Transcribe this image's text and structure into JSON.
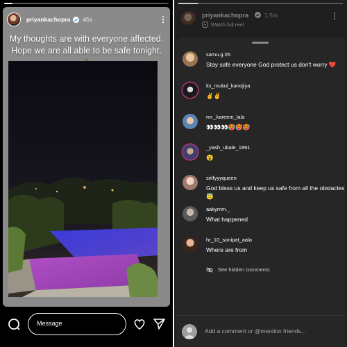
{
  "story": {
    "username": "priyankachopra",
    "time_ago": "45s",
    "caption": "My thoughts are with everyone affected. Hope we are all able to be safe tonight.",
    "caption_emoji": "🙏🏽",
    "message_placeholder": "Message",
    "progress": 0.05
  },
  "comments_view": {
    "username": "priyankachopra",
    "time_ago": "1.5m",
    "watch_full_reel": "Watch full reel",
    "comments": [
      {
        "user": "samu.g.05",
        "text": "Stay safe everyone God protect us don't worry ❤️",
        "avatar_color": "#c9a27a"
      },
      {
        "user": "its_mukul_kanojiya",
        "text": "✌️✌️",
        "avatar_color": "#2b2b2b"
      },
      {
        "user": "mr._kareem_lala",
        "text": "👀👀👀🥵🥵🥵",
        "avatar_color": "#7fa4c9"
      },
      {
        "user": "_yash_ubale_1891",
        "text": "😮",
        "avatar_color": "#4a4a7a"
      },
      {
        "user": "selfyyyqueen",
        "text": "God bless us and keep us safe from all the obstacles😇",
        "avatar_color": "#d8b3a5"
      },
      {
        "user": "aakymm._",
        "text": "What happened",
        "avatar_color": "#8c8c8c"
      },
      {
        "user": "hr_10_sonipat_aala",
        "text": "Where are from",
        "avatar_color": "#c48a6a"
      }
    ],
    "see_hidden": "See hidden comments",
    "add_comment_placeholder": "Add a comment or @mention friends..."
  },
  "colors": {
    "panel_bg": "#1f1f1f",
    "sheet_bg": "#262626",
    "verified": "#3897f0",
    "story_ring": "#c13584"
  },
  "icons": [
    "camera-icon",
    "heart-icon",
    "send-icon",
    "more-icon",
    "verified-icon",
    "reel-icon",
    "eye-slash-icon"
  ]
}
